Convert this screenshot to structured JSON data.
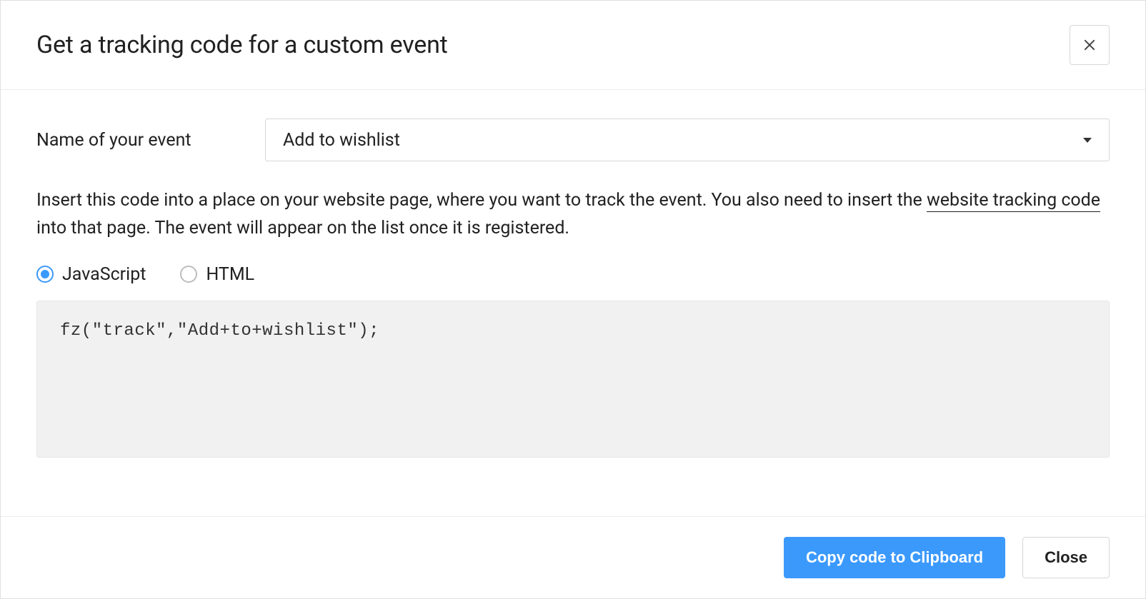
{
  "header": {
    "title": "Get a tracking code for a custom event"
  },
  "form": {
    "event_label": "Name of your event",
    "event_selected": "Add to wishlist"
  },
  "instruction": {
    "part1": "Insert this code into a place on your website page, where you want to track the event. You also need to insert the ",
    "link_text": "website tracking code",
    "part2": " into that page. The event will appear on the list once it is registered."
  },
  "code_format": {
    "option_js": "JavaScript",
    "option_html": "HTML",
    "selected": "JavaScript"
  },
  "code_snippet": "fz(\"track\",\"Add+to+wishlist\");",
  "footer": {
    "copy_btn": "Copy code to Clipboard",
    "close_btn": "Close"
  }
}
